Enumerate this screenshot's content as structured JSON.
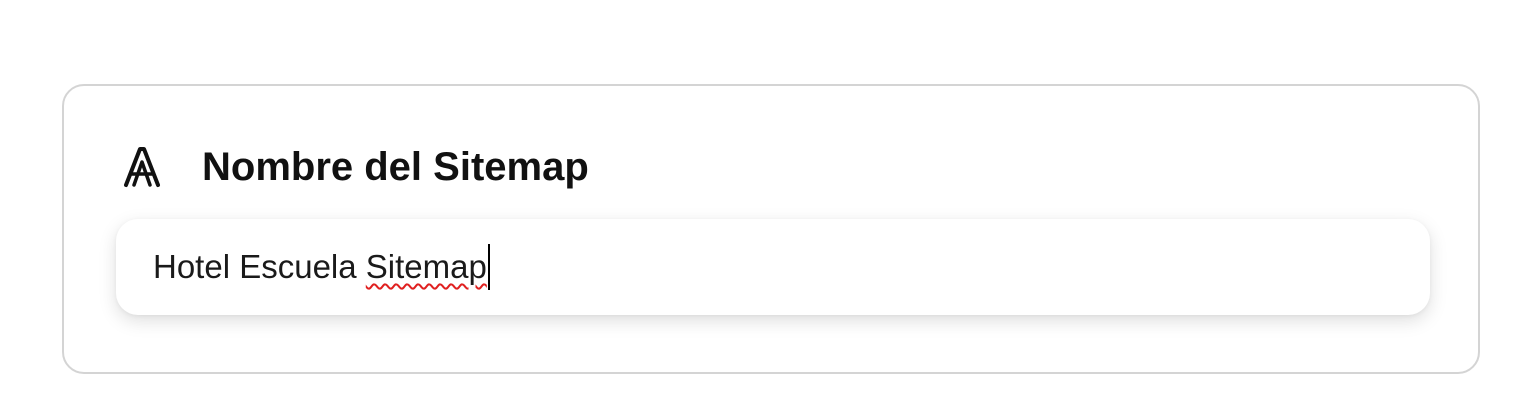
{
  "section": {
    "icon": "font-letter-a-icon",
    "title": "Nombre del Sitemap"
  },
  "input": {
    "value_prefix": "Hotel Escuela ",
    "value_misspelled": "Sitemap",
    "spellcheck_color": "#e02020"
  }
}
